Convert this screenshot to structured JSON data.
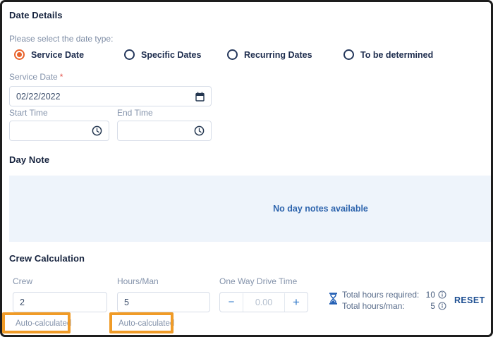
{
  "date_details": {
    "title": "Date Details",
    "hint": "Please select the date type:",
    "radio_options": [
      {
        "label": "Service Date",
        "selected": true
      },
      {
        "label": "Specific Dates",
        "selected": false
      },
      {
        "label": "Recurring Dates",
        "selected": false
      },
      {
        "label": "To be determined",
        "selected": false
      }
    ],
    "service_date": {
      "label": "Service Date",
      "required_mark": "*",
      "value": "02/22/2022"
    },
    "start_time": {
      "label": "Start Time",
      "value": ""
    },
    "end_time": {
      "label": "End Time",
      "value": ""
    }
  },
  "day_note": {
    "title": "Day Note",
    "empty_message": "No day notes available"
  },
  "crew_calculation": {
    "title": "Crew Calculation",
    "crew": {
      "label": "Crew",
      "value": "2",
      "note": "Auto-calculated"
    },
    "hours_man": {
      "label": "Hours/Man",
      "value": "5",
      "note": "Auto-calculated"
    },
    "drive_time": {
      "label": "One Way Drive Time",
      "placeholder": "0.00",
      "minus_label": "−",
      "plus_label": "+"
    },
    "totals": [
      {
        "label": "Total hours required:",
        "value": "10"
      },
      {
        "label": "Total hours/man:",
        "value": "5"
      }
    ],
    "reset_label": "RESET"
  },
  "icons": {
    "calendar": "calendar-icon",
    "clock": "clock-icon",
    "hourglass": "hourglass-icon",
    "info": "info-icon"
  },
  "colors": {
    "selected_radio_orange": "#e8632c",
    "highlight_box_orange": "#f09b27",
    "panel_blue": "#eef4fb",
    "empty_message_blue": "#2d64ad",
    "reset_blue": "#1c4e91",
    "stepper_blue": "#3078c8",
    "heading_navy": "#16233e",
    "label_gray": "#8392aa",
    "required_red": "#e4504a",
    "input_border": "#d7dde8"
  }
}
